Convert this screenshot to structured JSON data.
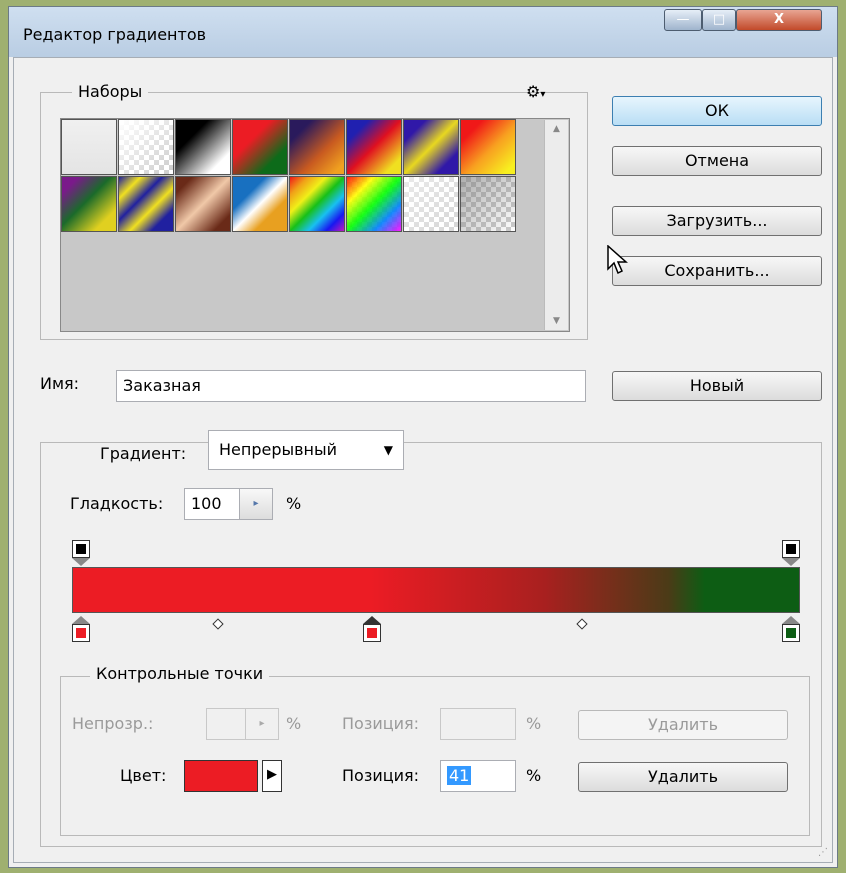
{
  "window": {
    "title": "Редактор градиентов",
    "controls": {
      "minimize": "—",
      "maximize": "□",
      "close": "X"
    }
  },
  "presets": {
    "legend": "Наборы",
    "menu_icon": "gear-icon",
    "rows": [
      [
        {
          "kind": "solid",
          "bg": "linear-gradient(#f0f0f0,#e4e4e4)"
        },
        {
          "kind": "checker",
          "bg": "linear-gradient(135deg,rgba(255,255,255,1),rgba(255,255,255,0))"
        },
        {
          "kind": "solid",
          "bg": "linear-gradient(135deg,#000 30%,#fff 80%)"
        },
        {
          "kind": "solid",
          "bg": "linear-gradient(135deg,#ec1c24 35%,#0d6b1a 75%)"
        },
        {
          "kind": "solid",
          "bg": "linear-gradient(135deg,#2a1a5c 20%,#c85a20 60%,#f0a020 90%)"
        },
        {
          "kind": "solid",
          "bg": "linear-gradient(135deg,#2020b0 20%,#e01020 50%,#f0e020 85%)"
        },
        {
          "kind": "solid",
          "bg": "linear-gradient(135deg,#3018a8 20%,#e8d820 50%,#3018a8 80%)"
        },
        {
          "kind": "solid",
          "bg": "linear-gradient(135deg,#f01818 20%,#f8a020 55%,#f8f020 90%)"
        }
      ],
      [
        {
          "kind": "solid",
          "bg": "linear-gradient(135deg,#7a1a8a 15%,#1a6a2a 45%,#e0d020 80%)"
        },
        {
          "kind": "solid",
          "bg": "linear-gradient(135deg,#2020a0 0%,#f0e020 20%,#2020a0 40%,#f0e020 60%,#2020a0 80%)"
        },
        {
          "kind": "solid",
          "bg": "linear-gradient(135deg,#6a2a18 15%,#f0c8a8 50%,#6a2a18 85%)"
        },
        {
          "kind": "solid",
          "bg": "linear-gradient(135deg,#1870c0 30%,#ffffff 50%,#e8a020 70%)"
        },
        {
          "kind": "solid",
          "bg": "linear-gradient(135deg,#f01818,#f0a018,#f0f018,#18c018,#18c0f0,#1818f0,#c018c0)"
        },
        {
          "kind": "checker",
          "bg": "linear-gradient(135deg,rgba(255,0,0,0.9),rgba(255,255,0,0.9),rgba(0,255,0,0.9),rgba(0,128,255,0.9),rgba(255,0,255,0.9))"
        },
        {
          "kind": "checker",
          "bg": "linear-gradient(135deg,rgba(255,255,255,0.6),rgba(255,255,255,0.2))"
        },
        {
          "kind": "checker",
          "bg": "linear-gradient(135deg,rgba(120,120,120,0.6),rgba(255,255,255,0))"
        }
      ]
    ]
  },
  "buttons": {
    "ok": "ОК",
    "cancel": "Отмена",
    "load": "Загрузить...",
    "save": "Сохранить...",
    "new": "Новый"
  },
  "name": {
    "label": "Имя:",
    "value": "Заказная"
  },
  "gradient": {
    "type_label": "Градиент:",
    "type_value": "Непрерывный",
    "smoothness_label": "Гладкость:",
    "smoothness_value": "100",
    "smoothness_unit": "%",
    "colors": {
      "red": "#ec1c24",
      "green": "#0d5d14",
      "black": "#000000"
    },
    "color_stops": [
      {
        "location": 0,
        "color": "#ec1c24"
      },
      {
        "location": 41,
        "color": "#ec1c24",
        "selected": true
      },
      {
        "location": 100,
        "color": "#0d5d14"
      }
    ],
    "opacity_stops": [
      {
        "location": 0,
        "color": "#000000"
      },
      {
        "location": 100,
        "color": "#000000"
      }
    ],
    "midpoints": [
      20,
      70
    ]
  },
  "stops_panel": {
    "legend": "Контрольные точки",
    "opacity_label": "Непрозр.:",
    "opacity_unit": "%",
    "opacity_position_label": "Позиция:",
    "opacity_position_unit": "%",
    "opacity_delete": "Удалить",
    "color_label": "Цвет:",
    "color_value": "#ec1c24",
    "color_position_label": "Позиция:",
    "color_position_value": "41",
    "color_position_unit": "%",
    "color_delete": "Удалить"
  }
}
